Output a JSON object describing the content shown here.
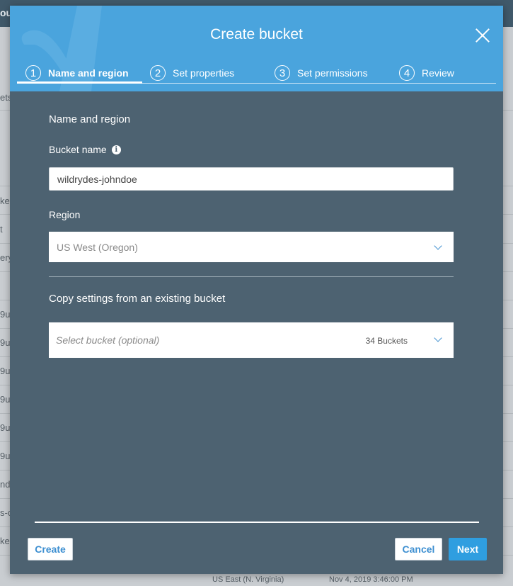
{
  "background": {
    "topbar_fragment": "ou",
    "left_fragments": [
      "ets",
      "ked",
      "t",
      "ery",
      "9u",
      "9u",
      "9u",
      "9u",
      "9u",
      "9u",
      "nd",
      "s-c",
      "ked"
    ],
    "bottom_fragments": [
      "US East (N. Virginia)",
      "Nov 4, 2019 3:46:00 PM"
    ]
  },
  "modal": {
    "title": "Create bucket",
    "steps": [
      {
        "number": "1",
        "label": "Name and region"
      },
      {
        "number": "2",
        "label": "Set properties"
      },
      {
        "number": "3",
        "label": "Set permissions"
      },
      {
        "number": "4",
        "label": "Review"
      }
    ],
    "active_step": 1
  },
  "form": {
    "section_title": "Name and region",
    "bucket_name_label": "Bucket name",
    "bucket_name_value": "wildrydes-johndoe",
    "region_label": "Region",
    "region_value": "US West (Oregon)",
    "copy_title": "Copy settings from an existing bucket",
    "select_bucket_placeholder": "Select bucket (optional)",
    "bucket_count": "34 Buckets"
  },
  "footer": {
    "create_label": "Create",
    "cancel_label": "Cancel",
    "next_label": "Next"
  },
  "colors": {
    "header": "#4aa4dd",
    "modal_body": "#4d6271",
    "primary_button": "#2f9ee0",
    "link_blue": "#3d8fd1"
  },
  "icons": {
    "close": "close-icon",
    "info": "info-icon",
    "dropdown": "chevron-down-icon"
  }
}
